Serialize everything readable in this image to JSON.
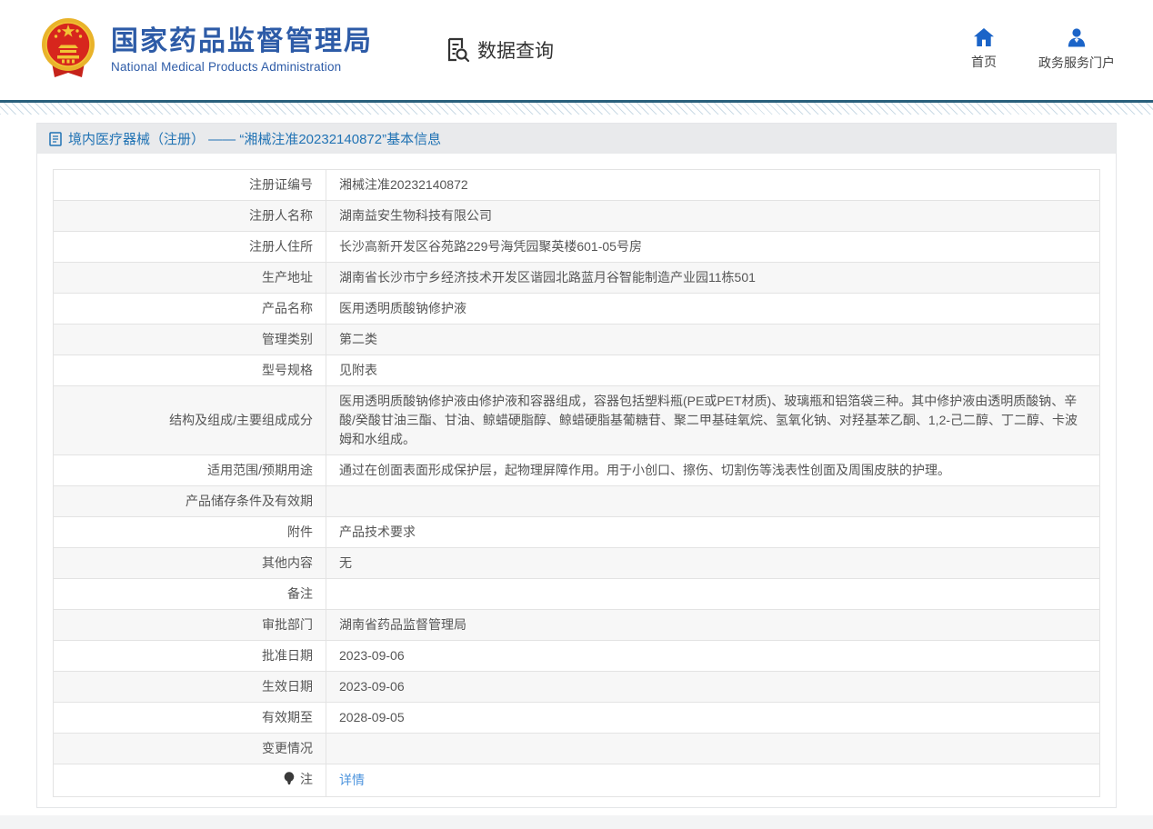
{
  "header": {
    "logo_title": "国家药品监督管理局",
    "logo_subtitle": "National Medical Products Administration",
    "section_title": "数据查询",
    "nav_home": "首页",
    "nav_portal": "政务服务门户"
  },
  "breadcrumb": {
    "text": "境内医疗器械（注册） —— “湘械注准20232140872”基本信息"
  },
  "table": {
    "rows": [
      {
        "label": "注册证编号",
        "value": "湘械注准20232140872"
      },
      {
        "label": "注册人名称",
        "value": "湖南益安生物科技有限公司"
      },
      {
        "label": "注册人住所",
        "value": "长沙高新开发区谷苑路229号海凭园聚英楼601-05号房"
      },
      {
        "label": "生产地址",
        "value": "湖南省长沙市宁乡经济技术开发区谐园北路蓝月谷智能制造产业园11栋501"
      },
      {
        "label": "产品名称",
        "value": "医用透明质酸钠修护液"
      },
      {
        "label": "管理类别",
        "value": "第二类"
      },
      {
        "label": "型号规格",
        "value": "见附表"
      },
      {
        "label": "结构及组成/主要组成成分",
        "value": "医用透明质酸钠修护液由修护液和容器组成，容器包括塑料瓶(PE或PET材质)、玻璃瓶和铝箔袋三种。其中修护液由透明质酸钠、辛酸/癸酸甘油三酯、甘油、鲸蜡硬脂醇、鲸蜡硬脂基葡糖苷、聚二甲基硅氧烷、氢氧化钠、对羟基苯乙酮、1,2-己二醇、丁二醇、卡波姆和水组成。"
      },
      {
        "label": "适用范围/预期用途",
        "value": "通过在创面表面形成保护层，起物理屏障作用。用于小创口、擦伤、切割伤等浅表性创面及周围皮肤的护理。"
      },
      {
        "label": "产品储存条件及有效期",
        "value": ""
      },
      {
        "label": "附件",
        "value": "产品技术要求"
      },
      {
        "label": "其他内容",
        "value": "无"
      },
      {
        "label": "备注",
        "value": ""
      },
      {
        "label": "审批部门",
        "value": "湖南省药品监督管理局"
      },
      {
        "label": "批准日期",
        "value": "2023-09-06"
      },
      {
        "label": "生效日期",
        "value": "2023-09-06"
      },
      {
        "label": "有效期至",
        "value": "2028-09-05"
      },
      {
        "label": "变更情况",
        "value": ""
      },
      {
        "label": "注",
        "value": "详情",
        "link": true,
        "icon": "note-icon"
      }
    ]
  },
  "colors": {
    "brand_blue": "#2d5ba7",
    "nav_icon_blue": "#1b64c8",
    "divider_teal": "#2a607c",
    "breadcrumb_blue": "#2173b4",
    "link_blue": "#4b93dd",
    "row_alt_gray": "#f7f7f7",
    "emblem_red": "#d7261d",
    "emblem_gold": "#e9b32a"
  }
}
